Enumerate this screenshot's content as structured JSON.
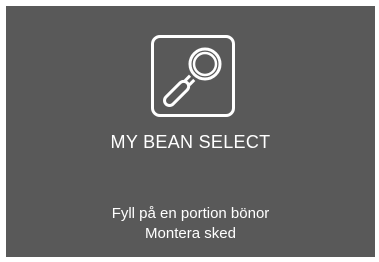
{
  "screen": {
    "icon": "spoon-icon",
    "title": "MY BEAN SELECT",
    "instructions": [
      "Fyll på en portion bönor",
      "Montera sked"
    ]
  },
  "colors": {
    "background": "#595959",
    "foreground": "#ffffff"
  }
}
